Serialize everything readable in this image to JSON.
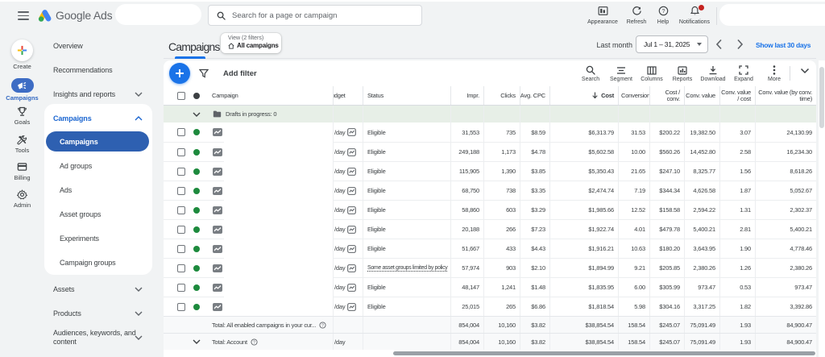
{
  "header": {
    "brand": "Google Ads",
    "search_placeholder": "Search for a page or campaign",
    "actions": [
      {
        "label": "Appearance"
      },
      {
        "label": "Refresh"
      },
      {
        "label": "Help"
      },
      {
        "label": "Notifications",
        "badge": true
      }
    ]
  },
  "rail": {
    "items": [
      {
        "label": "Create"
      },
      {
        "label": "Campaigns",
        "active": true
      },
      {
        "label": "Goals"
      },
      {
        "label": "Tools"
      },
      {
        "label": "Billing"
      },
      {
        "label": "Admin"
      }
    ]
  },
  "nav": {
    "top_items": [
      {
        "label": "Overview"
      },
      {
        "label": "Recommendations"
      },
      {
        "label": "Insights and reports",
        "chevron": "down"
      }
    ],
    "section": {
      "label": "Campaigns",
      "chevron": "up",
      "items": [
        {
          "label": "Campaigns",
          "selected": true
        },
        {
          "label": "Ad groups"
        },
        {
          "label": "Ads"
        },
        {
          "label": "Asset groups"
        },
        {
          "label": "Experiments"
        },
        {
          "label": "Campaign groups"
        }
      ]
    },
    "bottom_items": [
      {
        "label": "Assets",
        "chevron": "down"
      },
      {
        "label": "Products",
        "chevron": "down"
      },
      {
        "label": "Audiences, keywords, and content",
        "chevron": "down"
      }
    ]
  },
  "page": {
    "title": "Campaigns",
    "view_chip": {
      "line1": "View (2 filters)",
      "line2": "All campaigns"
    },
    "date": {
      "preset": "Last month",
      "range": "Jul 1 – 31, 2025",
      "link": "Show last 30 days"
    }
  },
  "toolbar": {
    "add_filter": "Add filter",
    "actions": [
      {
        "label": "Search"
      },
      {
        "label": "Segment"
      },
      {
        "label": "Columns"
      },
      {
        "label": "Reports"
      },
      {
        "label": "Download"
      },
      {
        "label": "Expand"
      },
      {
        "label": "More"
      }
    ]
  },
  "table": {
    "columns": {
      "campaign": "Campaign",
      "budget": "Budget",
      "status": "Status",
      "impr": "Impr.",
      "clicks": "Clicks",
      "cpc": "Avg. CPC",
      "cost": "Cost",
      "conv": "Conversions",
      "cost_conv": "Cost / conv.",
      "conv_value": "Conv. value",
      "conv_value_cost": "Conv. value / cost",
      "conv_value_time": "Conv. value (by conv. time)"
    },
    "drafts_row": {
      "label": "Drafts in progress: 0"
    },
    "rows": [
      {
        "budget": "/day",
        "status": "Eligible",
        "impr": "31,553",
        "clicks": "735",
        "cpc": "$8.59",
        "cost": "$6,313.79",
        "conv": "31.53",
        "cost_conv": "$200.22",
        "conv_value": "19,382.50",
        "conv_value_cost": "3.07",
        "conv_value_time": "24,130.99"
      },
      {
        "budget": "/day",
        "status": "Eligible",
        "impr": "249,188",
        "clicks": "1,173",
        "cpc": "$4.78",
        "cost": "$5,602.58",
        "conv": "10.00",
        "cost_conv": "$560.26",
        "conv_value": "14,452.80",
        "conv_value_cost": "2.58",
        "conv_value_time": "16,234.30"
      },
      {
        "budget": "/day",
        "status": "Eligible",
        "impr": "115,905",
        "clicks": "1,390",
        "cpc": "$3.85",
        "cost": "$5,350.43",
        "conv": "21.65",
        "cost_conv": "$247.10",
        "conv_value": "8,325.77",
        "conv_value_cost": "1.56",
        "conv_value_time": "8,618.26"
      },
      {
        "budget": "/day",
        "status": "Eligible",
        "impr": "68,750",
        "clicks": "738",
        "cpc": "$3.35",
        "cost": "$2,474.74",
        "conv": "7.19",
        "cost_conv": "$344.34",
        "conv_value": "4,626.58",
        "conv_value_cost": "1.87",
        "conv_value_time": "5,052.67"
      },
      {
        "budget": "/day",
        "status": "Eligible",
        "impr": "58,860",
        "clicks": "603",
        "cpc": "$3.29",
        "cost": "$1,985.66",
        "conv": "12.52",
        "cost_conv": "$158.58",
        "conv_value": "2,594.22",
        "conv_value_cost": "1.31",
        "conv_value_time": "2,302.37"
      },
      {
        "budget": "/day",
        "status": "Eligible",
        "impr": "20,188",
        "clicks": "266",
        "cpc": "$7.23",
        "cost": "$1,922.74",
        "conv": "4.01",
        "cost_conv": "$479.78",
        "conv_value": "5,400.21",
        "conv_value_cost": "2.81",
        "conv_value_time": "5,400.21"
      },
      {
        "budget": "/day",
        "status": "Eligible",
        "impr": "51,667",
        "clicks": "433",
        "cpc": "$4.43",
        "cost": "$1,916.21",
        "conv": "10.63",
        "cost_conv": "$180.20",
        "conv_value": "3,643.95",
        "conv_value_cost": "1.90",
        "conv_value_time": "4,778.46"
      },
      {
        "budget": "/day",
        "status": "Some asset groups limited by policy",
        "status_underline": true,
        "impr": "57,974",
        "clicks": "903",
        "cpc": "$2.10",
        "cost": "$1,894.99",
        "conv": "9.21",
        "cost_conv": "$205.85",
        "conv_value": "2,380.26",
        "conv_value_cost": "1.26",
        "conv_value_time": "2,380.26"
      },
      {
        "budget": "/day",
        "status": "Eligible",
        "impr": "48,147",
        "clicks": "1,241",
        "cpc": "$1.48",
        "cost": "$1,835.95",
        "conv": "6.00",
        "cost_conv": "$305.99",
        "conv_value": "973.47",
        "conv_value_cost": "0.53",
        "conv_value_time": "973.47"
      },
      {
        "budget": "/day",
        "status": "Eligible",
        "impr": "25,015",
        "clicks": "265",
        "cpc": "$6.86",
        "cost": "$1,818.54",
        "conv": "5.98",
        "cost_conv": "$304.16",
        "conv_value": "3,317.25",
        "conv_value_cost": "1.82",
        "conv_value_time": "3,392.86"
      }
    ],
    "totals": [
      {
        "label": "Total: All enabled campaigns in your cur...",
        "impr": "854,004",
        "clicks": "10,160",
        "cpc": "$3.82",
        "cost": "$38,854.54",
        "conv": "158.54",
        "cost_conv": "$245.07",
        "conv_value": "75,091.49",
        "conv_value_cost": "1.93",
        "conv_value_time": "84,900.47"
      },
      {
        "label": "Total: Account",
        "budget": "/day",
        "impr": "854,004",
        "clicks": "10,160",
        "cpc": "$3.82",
        "cost": "$38,854.54",
        "conv": "158.54",
        "cost_conv": "$245.07",
        "conv_value": "75,091.49",
        "conv_value_cost": "1.93",
        "conv_value_time": "84,900.47"
      }
    ]
  },
  "colors": {
    "accent_blue": "#1a73e8",
    "nav_pill_blue": "#2e60b1",
    "rail_pill_blue": "#3d6cc4",
    "enabled_green": "#1d8a3d",
    "drafts_row_green": "#e7efe7",
    "notification_red": "#c5221f"
  }
}
